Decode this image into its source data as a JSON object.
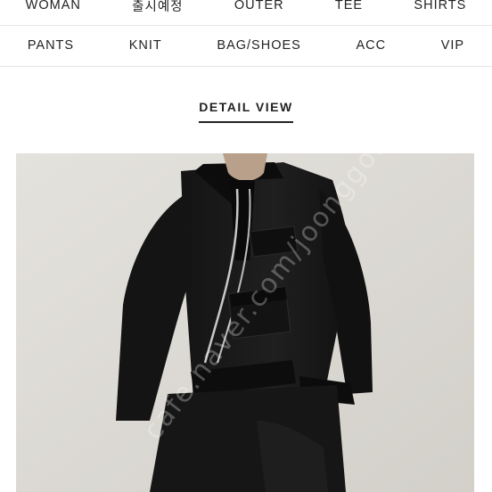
{
  "nav": {
    "row1": [
      "WOMAN",
      "출시예정",
      "OUTER",
      "TEE",
      "SHIRTS"
    ],
    "row2": [
      "PANTS",
      "KNIT",
      "BAG/SHOES",
      "ACC",
      "VIP"
    ]
  },
  "section": {
    "title": "DETAIL VIEW"
  },
  "photo": {
    "watermark": "cafe.naver.com/joonggonara"
  }
}
